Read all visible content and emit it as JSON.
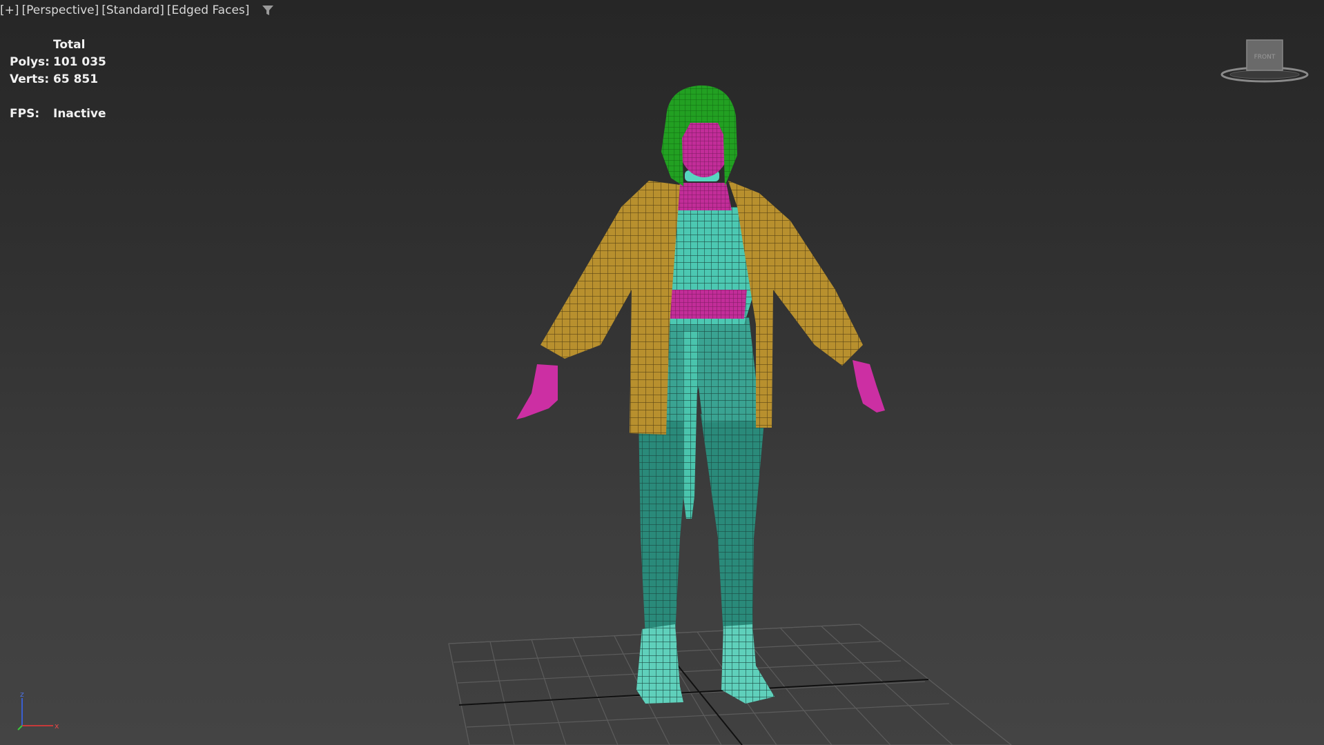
{
  "viewport": {
    "menu": {
      "plus": "[+]",
      "view": "[Perspective]",
      "shading": "[Standard]",
      "display": "[Edged Faces]"
    },
    "filter_icon": "filter-icon"
  },
  "stats": {
    "header": "Total",
    "polys_label": "Polys:",
    "polys_value": "101 035",
    "verts_label": "Verts:",
    "verts_value": "65 851",
    "fps_label": "FPS:",
    "fps_value": "Inactive"
  },
  "viewcube": {
    "face_label": "FRONT"
  },
  "axis": {
    "z": "z",
    "x": "x"
  },
  "colors": {
    "hair": "#22b022",
    "skin": "#cc2fa3",
    "clothing_wire": "#6fe0cc",
    "jacket_wire": "#e8b850",
    "grid": "#5a5a5a",
    "grid_axis": "#111111"
  }
}
